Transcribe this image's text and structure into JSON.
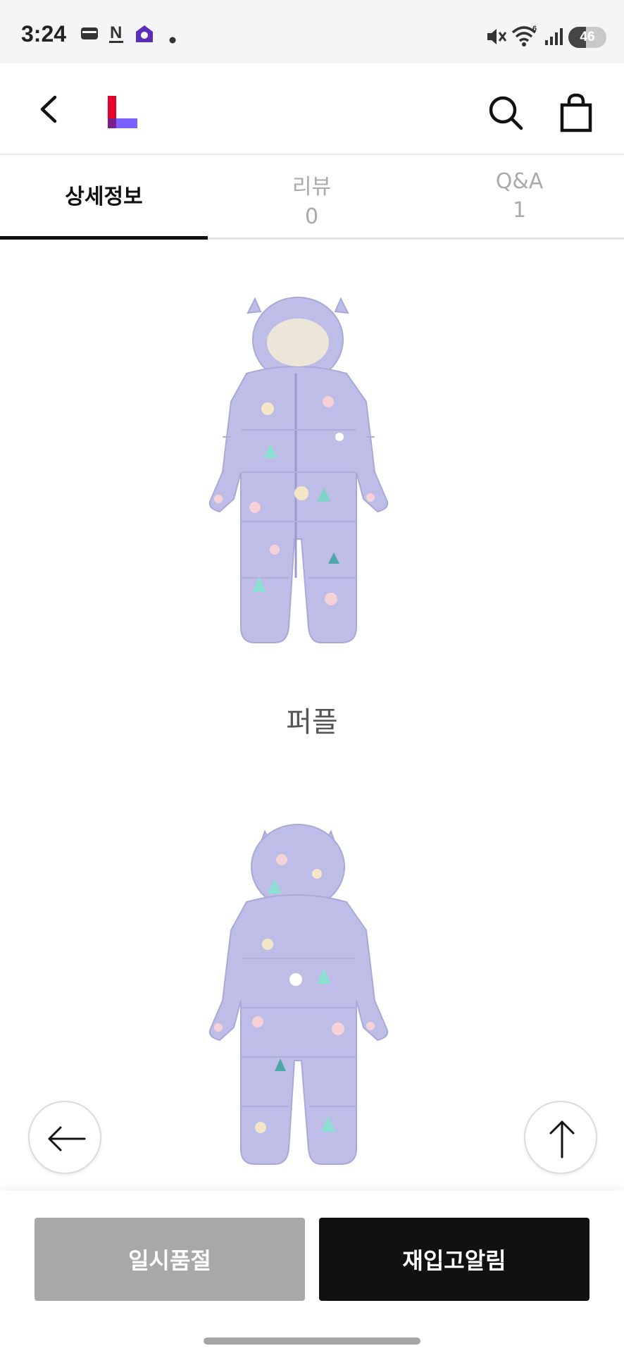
{
  "status_bar": {
    "time": "3:24",
    "battery_level": "46",
    "battery_fraction": 0.46,
    "icons": [
      "wallet-icon",
      "notion-icon",
      "home-app-icon",
      "dot-icon",
      "mute-icon",
      "wifi-icon",
      "signal-icon"
    ]
  },
  "header": {
    "back_icon": "chevron-left-icon",
    "logo": "lotte-l-logo",
    "search_icon": "search-icon",
    "cart_icon": "shopping-bag-icon"
  },
  "tabs": [
    {
      "label": "상세정보",
      "count": "",
      "active": true
    },
    {
      "label": "리뷰",
      "count": "0",
      "active": false
    },
    {
      "label": "Q&A",
      "count": "1",
      "active": false
    }
  ],
  "content": {
    "color_caption": "퍼플",
    "product_color": "#bdbde8"
  },
  "floating": {
    "back_arrow_icon": "arrow-left-icon",
    "scroll_top_icon": "arrow-up-icon"
  },
  "bottom_bar": {
    "soldout_label": "일시품절",
    "restock_label": "재입고알림"
  },
  "colors": {
    "accent_red": "#e4002b",
    "accent_purple": "#7b61ff",
    "suit_lavender": "#bdbde8"
  }
}
